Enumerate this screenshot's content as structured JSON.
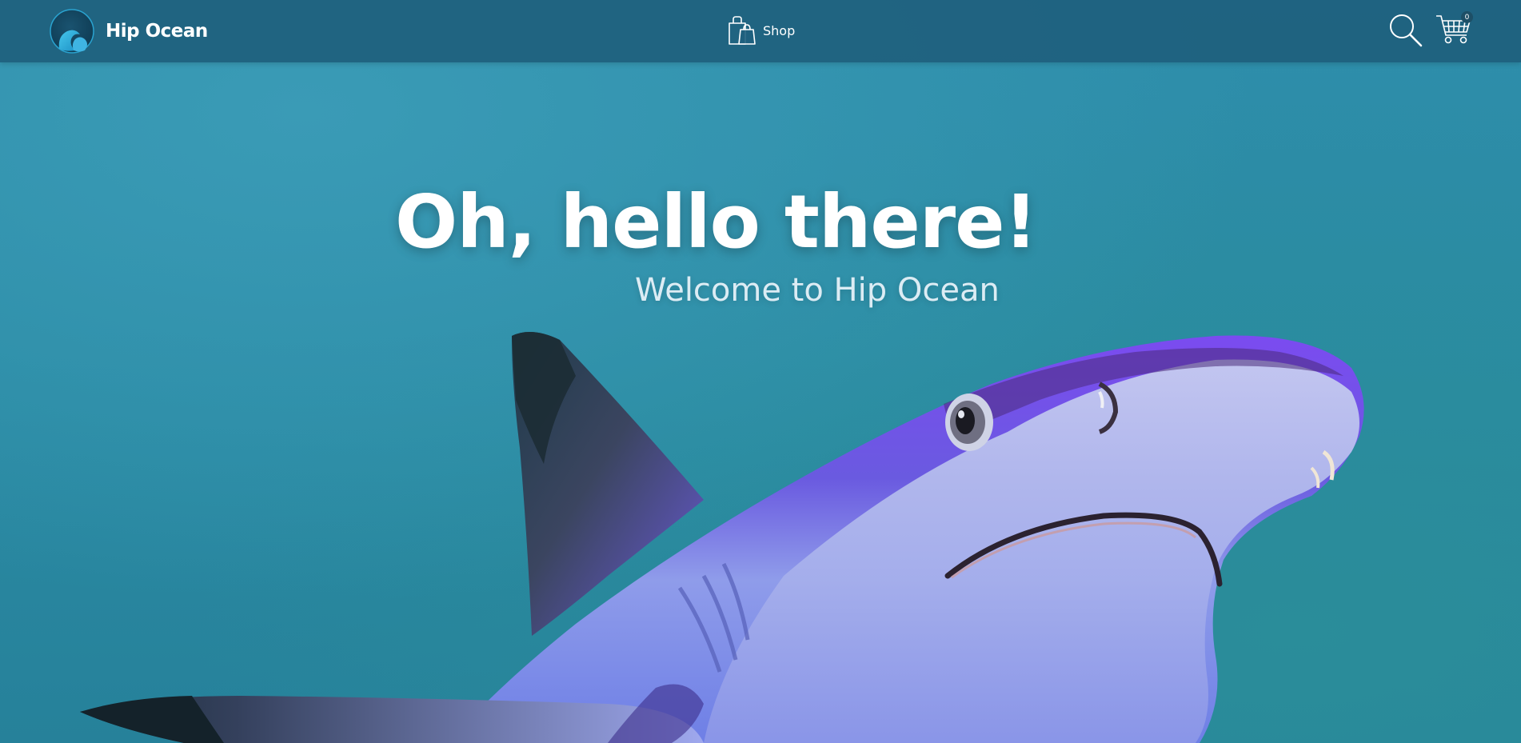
{
  "brand": {
    "name": "Hip Ocean",
    "logo_icon": "wave-logo-icon"
  },
  "nav": {
    "shop_label": "Shop",
    "shop_icon": "shopping-bags-icon",
    "search_icon": "search-icon",
    "cart_icon": "shopping-cart-icon",
    "cart_count": "0"
  },
  "hero": {
    "title": "Oh, hello there!",
    "subtitle": "Welcome to Hip Ocean",
    "background": "shark-photo"
  },
  "colors": {
    "navbar": "#1e5f7d",
    "ocean": "#2a8aa5",
    "shark_top": "#7a4ef0",
    "shark_belly": "#9aa4e8"
  }
}
